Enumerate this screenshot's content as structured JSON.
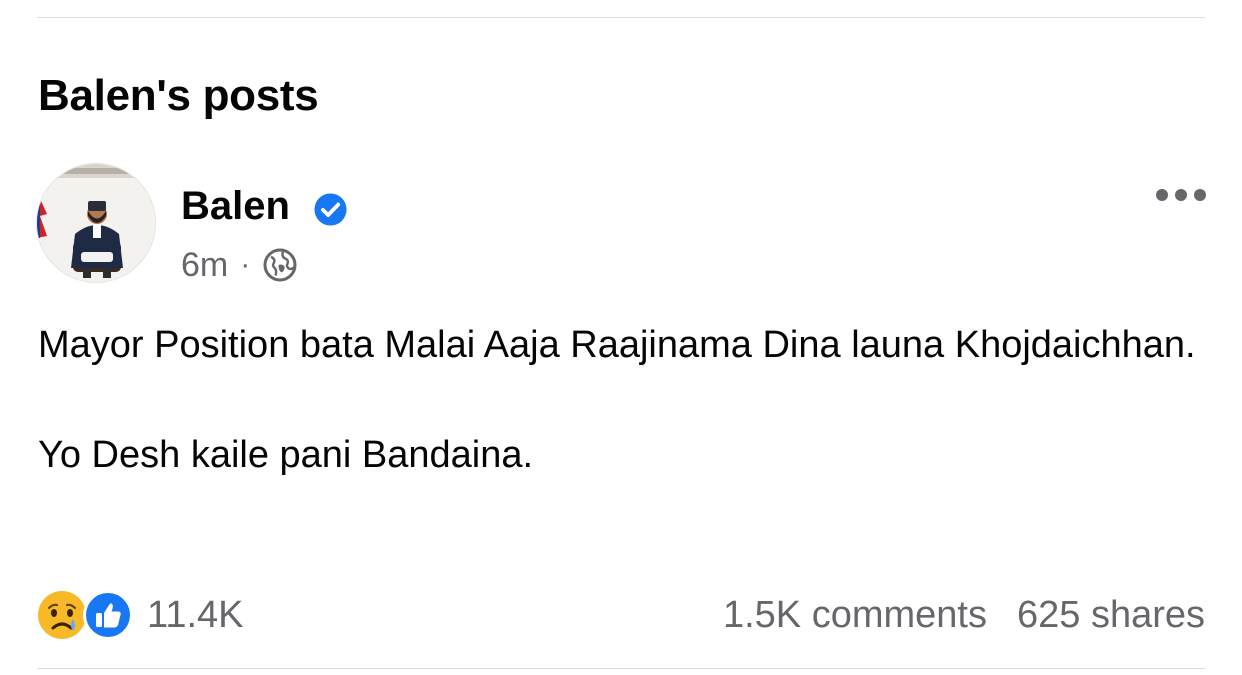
{
  "section": {
    "title": "Balen's posts"
  },
  "post": {
    "author": "Balen",
    "time": "6m",
    "separator": "·",
    "audience_icon": "globe-icon",
    "more_icon": "more-horizontal-icon",
    "verified_icon": "verified-badge-icon",
    "paragraphs": [
      "Mayor Position bata Malai Aaja Raajinama Dina launa Khojdaichhan.",
      "Yo Desh kaile pani Bandaina."
    ],
    "reactions": {
      "icons": [
        "sad-reaction-icon",
        "like-reaction-icon"
      ],
      "count": "11.4K"
    },
    "comments": "1.5K comments",
    "shares": "625 shares"
  },
  "colors": {
    "text": "#050505",
    "secondary": "#65676b",
    "verified_blue": "#1877f2",
    "divider": "#dcdde1"
  }
}
